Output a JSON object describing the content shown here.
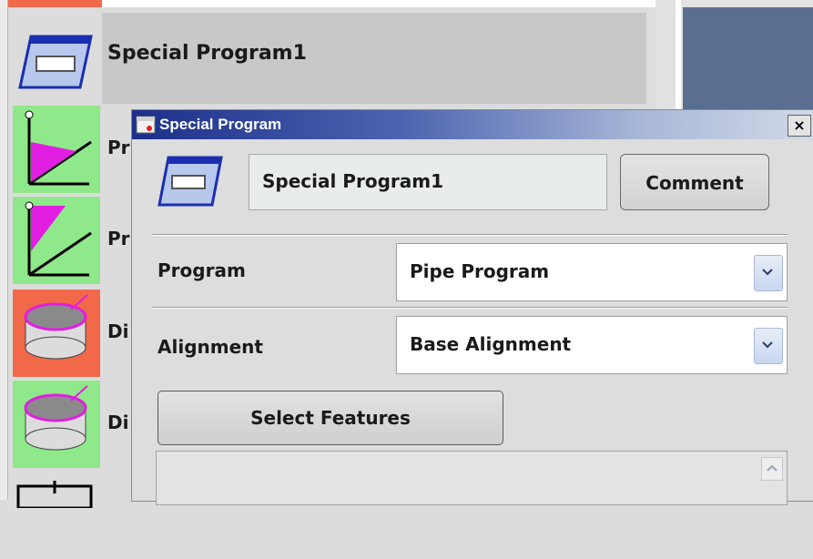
{
  "tree": {
    "items": [
      {
        "label": "Special Program1",
        "icon": "special-program-icon",
        "color": "#dcdcdc"
      },
      {
        "label": "Pr",
        "icon": "plane-axes-icon",
        "color": "#8fe88a"
      },
      {
        "label": "Pr",
        "icon": "plane-axes-icon",
        "color": "#8fe88a"
      },
      {
        "label": "Di",
        "icon": "cylinder-icon",
        "color": "#f2694a"
      },
      {
        "label": "Di",
        "icon": "cylinder-icon",
        "color": "#8fe88a"
      }
    ]
  },
  "dialog": {
    "title": "Special Program",
    "close_label": "×",
    "name_value": "Special Program1",
    "comment_label": "Comment",
    "program": {
      "label": "Program",
      "value": "Pipe Program"
    },
    "alignment": {
      "label": "Alignment",
      "value": "Base Alignment"
    },
    "select_features_label": "Select Features"
  }
}
